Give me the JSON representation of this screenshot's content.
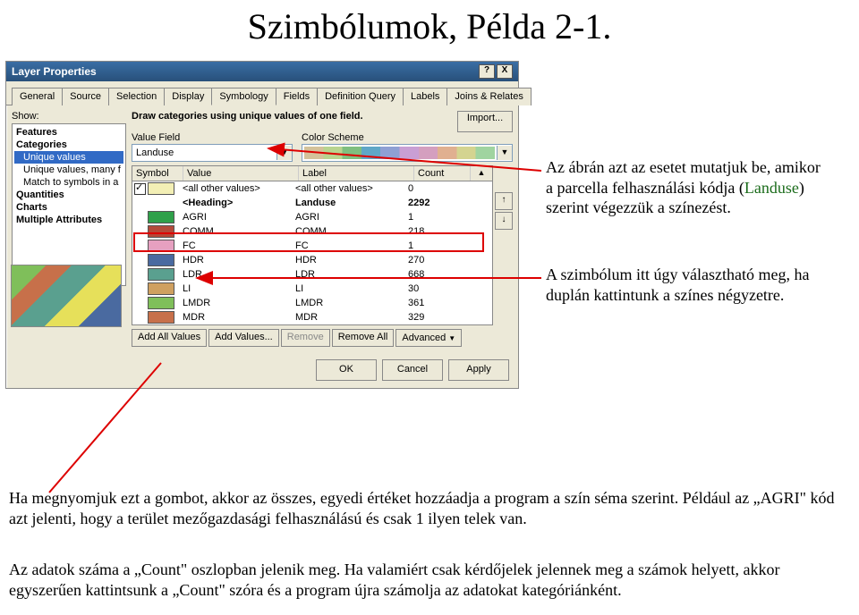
{
  "page_title": "Szimbólumok, Példa 2-1.",
  "dialog": {
    "title": "Layer Properties",
    "tabs": [
      "General",
      "Source",
      "Selection",
      "Display",
      "Symbology",
      "Fields",
      "Definition Query",
      "Labels",
      "Joins & Relates"
    ],
    "active_tab": "Symbology",
    "show_label": "Show:",
    "tree": [
      {
        "label": "Features",
        "bold": true
      },
      {
        "label": "Categories",
        "bold": true
      },
      {
        "label": "Unique values",
        "indent": true,
        "selected": true
      },
      {
        "label": "Unique values, many f",
        "indent": true
      },
      {
        "label": "Match to symbols in a",
        "indent": true
      },
      {
        "label": "Quantities",
        "bold": true
      },
      {
        "label": "Charts",
        "bold": true
      },
      {
        "label": "Multiple Attributes",
        "bold": true
      }
    ],
    "desc": "Draw categories using unique values of one field.",
    "import": "Import...",
    "value_field_label": "Value Field",
    "value_field": "Landuse",
    "color_scheme_label": "Color Scheme",
    "grid": {
      "headers": {
        "symbol": "Symbol",
        "value": "Value",
        "label": "Label",
        "count": "Count"
      },
      "rows": [
        {
          "kind": "all",
          "checked": true,
          "color": "#f3efb5",
          "value": "<all other values>",
          "label": "<all other values>",
          "count": "0"
        },
        {
          "kind": "heading",
          "value": "<Heading>",
          "label": "Landuse",
          "count": "2292"
        },
        {
          "kind": "cat",
          "color": "#2fa04a",
          "value": "AGRI",
          "label": "AGRI",
          "count": "1"
        },
        {
          "kind": "cat",
          "color": "#b44a3a",
          "value": "COMM",
          "label": "COMM",
          "count": "218"
        },
        {
          "kind": "cat",
          "color": "#e6a0c0",
          "value": "FC",
          "label": "FC",
          "count": "1"
        },
        {
          "kind": "cat",
          "color": "#4a6aa0",
          "value": "HDR",
          "label": "HDR",
          "count": "270"
        },
        {
          "kind": "cat",
          "color": "#5aa08f",
          "value": "LDR",
          "label": "LDR",
          "count": "668"
        },
        {
          "kind": "cat",
          "color": "#cfa060",
          "value": "LI",
          "label": "LI",
          "count": "30"
        },
        {
          "kind": "cat",
          "color": "#7fbf5a",
          "value": "LMDR",
          "label": "LMDR",
          "count": "361"
        },
        {
          "kind": "cat",
          "color": "#c7704a",
          "value": "MDR",
          "label": "MDR",
          "count": "329"
        }
      ]
    },
    "buttons": {
      "add_all": "Add All Values",
      "add": "Add Values...",
      "remove": "Remove",
      "remove_all": "Remove All",
      "advanced": "Advanced"
    },
    "footer": {
      "ok": "OK",
      "cancel": "Cancel",
      "apply": "Apply"
    }
  },
  "callouts": {
    "c1a": "Az ábrán azt az esetet mutatjuk be, amikor",
    "c1b_pre": "a parcella felhasználási kódja (",
    "c1b_land": "Landuse",
    "c1b_post": ")",
    "c1c": "szerint végezzük a színezést.",
    "c2a": "A szimbólum itt úgy választható meg, ha",
    "c2b": "duplán kattintunk a színes négyzetre."
  },
  "paragraphs": {
    "p1": "Ha megnyomjuk ezt a gombot, akkor az összes, egyedi értéket hozzáadja a program a szín séma szerint. Például az „AGRI\" kód azt jelenti, hogy a terület mezőgazdasági felhasználású és csak 1 ilyen telek van.",
    "p2": "Az adatok száma a „Count\" oszlopban jelenik meg. Ha valamiért csak kérdőjelek jelennek meg a számok helyett, akkor egyszerűen kattintsunk a „Count\" szóra és a program újra számolja az adatokat kategóriánként."
  }
}
